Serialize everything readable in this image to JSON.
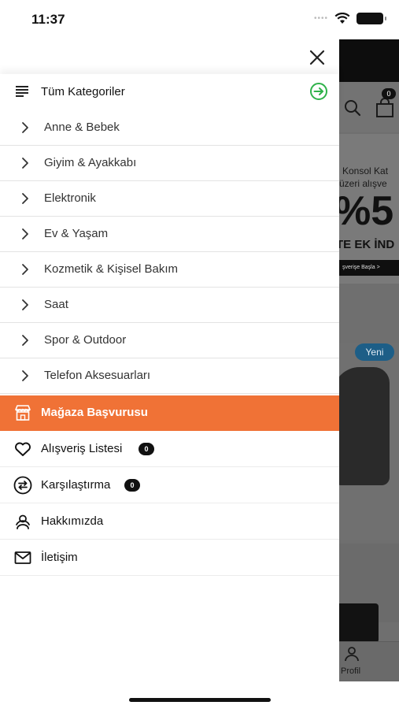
{
  "status_bar": {
    "time": "11:37"
  },
  "drawer": {
    "header": {
      "title": "Tüm Kategoriler"
    },
    "categories": [
      {
        "label": "Anne & Bebek"
      },
      {
        "label": "Giyim & Ayakkabı"
      },
      {
        "label": "Elektronik"
      },
      {
        "label": "Ev & Yaşam"
      },
      {
        "label": "Kozmetik & Kişisel Bakım"
      },
      {
        "label": "Saat"
      },
      {
        "label": "Spor & Outdoor"
      },
      {
        "label": "Telefon Aksesuarları"
      }
    ],
    "store_application": {
      "label": "Mağaza Başvurusu"
    },
    "menu": {
      "wishlist": {
        "label": "Alışveriş Listesi",
        "count": "0"
      },
      "compare": {
        "label": "Karşılaştırma",
        "count": "0"
      },
      "about": {
        "label": "Hakkımızda"
      },
      "contact": {
        "label": "İletişim"
      }
    }
  },
  "background_app": {
    "cart_count": "0",
    "banner": {
      "line1": "Konsol Kat",
      "line2": "üzeri alışve",
      "big": "%5",
      "line3": "TE EK İND",
      "cta": "şverişe Başla  >"
    },
    "product_badge": "Yeni",
    "tab_profile": "Profil"
  },
  "colors": {
    "accent_orange": "#f07236",
    "green_icon": "#2fb24a",
    "badge_black": "#111111"
  }
}
